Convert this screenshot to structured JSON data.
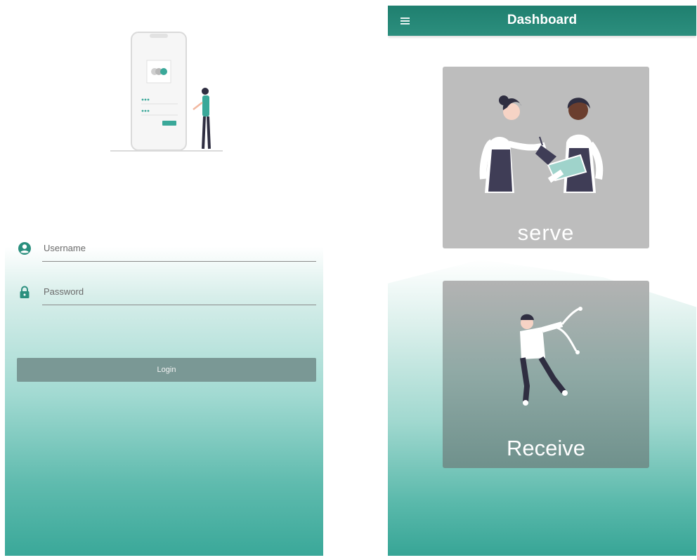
{
  "login": {
    "username_placeholder": "Username",
    "password_placeholder": "Password",
    "login_label": "Login",
    "icons": {
      "username": "account-circle-icon",
      "password": "lock-icon"
    }
  },
  "dashboard": {
    "title": "Dashboard",
    "menu_icon": "hamburger-menu-icon",
    "cards": [
      {
        "label": "serve"
      },
      {
        "label": "Receive"
      }
    ]
  },
  "colors": {
    "teal_primary": "#1f7f6f",
    "teal_gradient": "#3aa899",
    "icon_teal": "#2a8f7e",
    "card_gray": "#bdbdbd",
    "button_gray": "#7a9895"
  }
}
